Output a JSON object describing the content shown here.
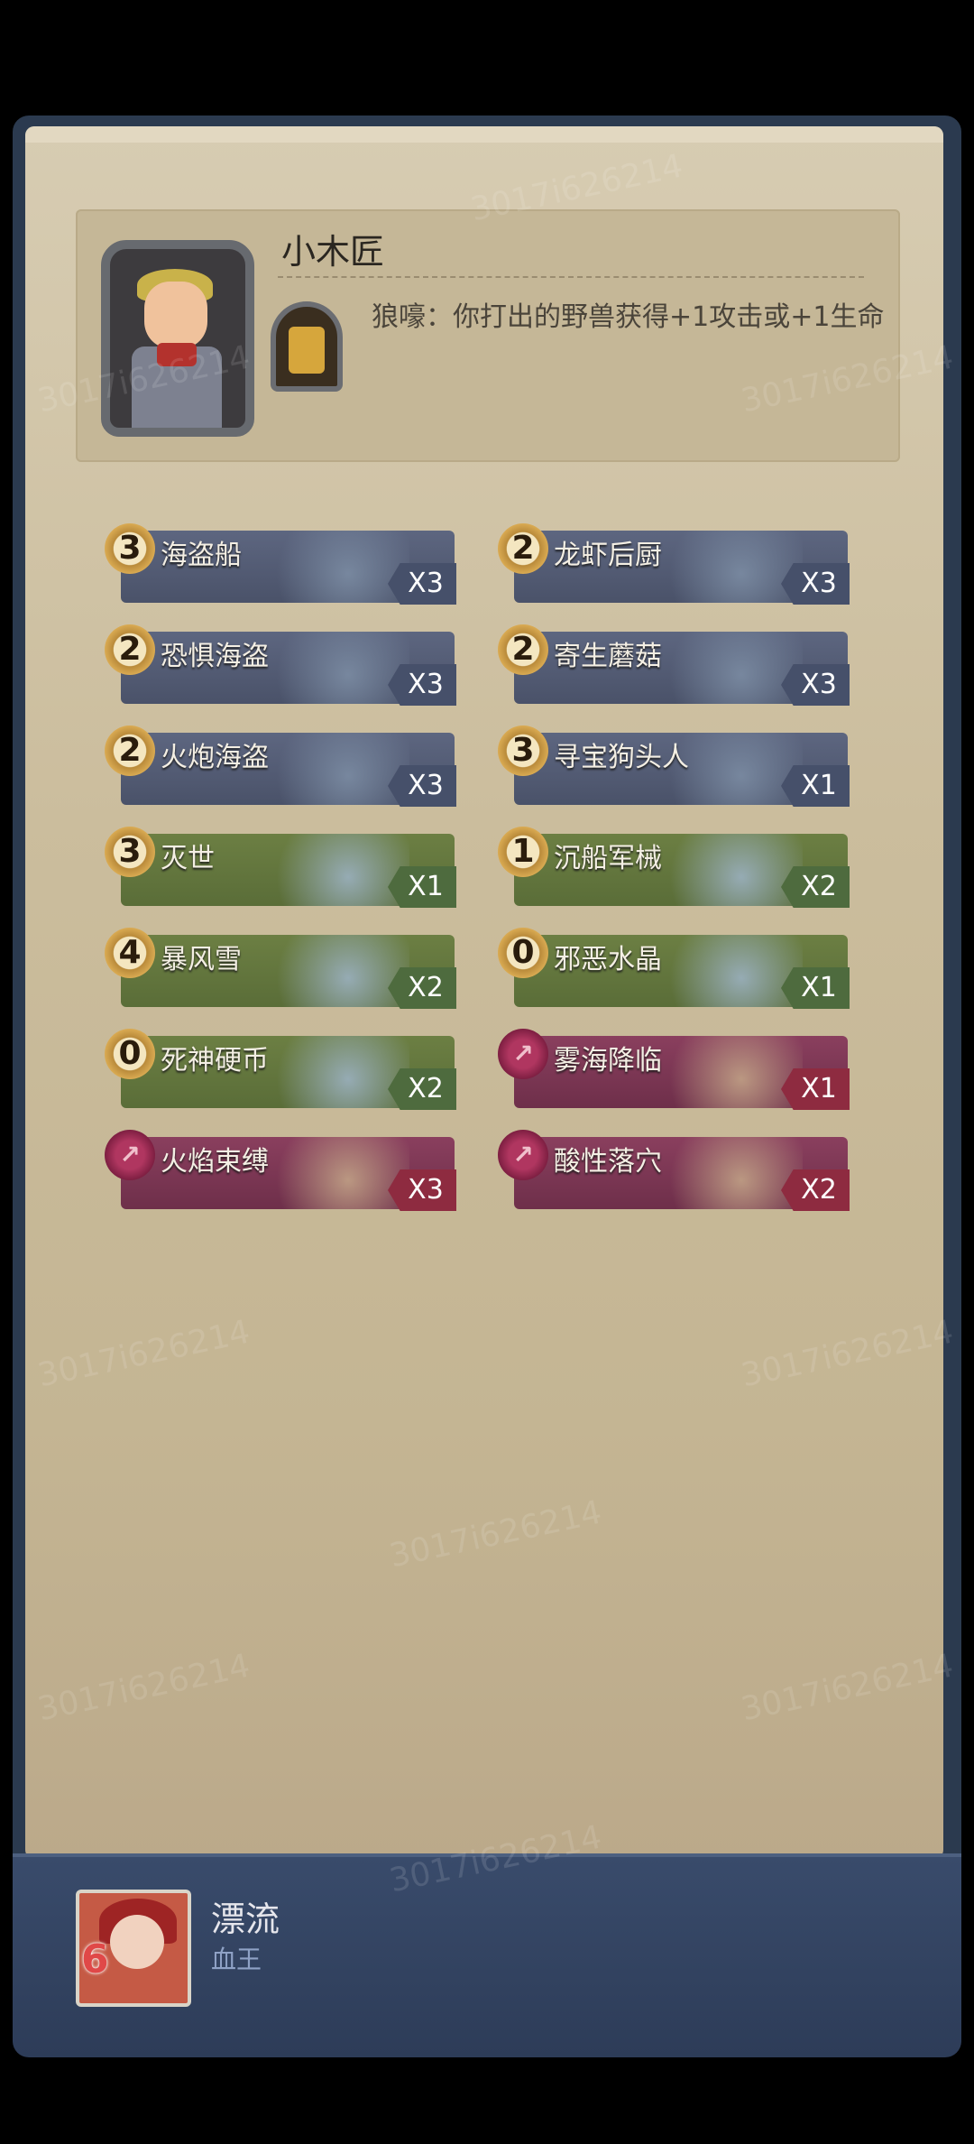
{
  "hero": {
    "name": "小木匠",
    "ability": "狼嚎：你打出的野兽获得+1攻击或+1生命"
  },
  "cards": [
    {
      "cost": "3",
      "name": "海盗船",
      "count": "X3",
      "kind": "minion"
    },
    {
      "cost": "2",
      "name": "龙虾后厨",
      "count": "X3",
      "kind": "minion"
    },
    {
      "cost": "2",
      "name": "恐惧海盗",
      "count": "X3",
      "kind": "minion"
    },
    {
      "cost": "2",
      "name": "寄生蘑菇",
      "count": "X3",
      "kind": "minion"
    },
    {
      "cost": "2",
      "name": "火炮海盗",
      "count": "X3",
      "kind": "minion"
    },
    {
      "cost": "3",
      "name": "寻宝狗头人",
      "count": "X1",
      "kind": "minion"
    },
    {
      "cost": "3",
      "name": "灭世",
      "count": "X1",
      "kind": "spell"
    },
    {
      "cost": "1",
      "name": "沉船军械",
      "count": "X2",
      "kind": "spell"
    },
    {
      "cost": "4",
      "name": "暴风雪",
      "count": "X2",
      "kind": "spell"
    },
    {
      "cost": "0",
      "name": "邪恶水晶",
      "count": "X1",
      "kind": "spell"
    },
    {
      "cost": "0",
      "name": "死神硬币",
      "count": "X2",
      "kind": "spell"
    },
    {
      "cost": "",
      "name": "雾海降临",
      "count": "X1",
      "kind": "quest"
    },
    {
      "cost": "",
      "name": "火焰束缚",
      "count": "X3",
      "kind": "quest"
    },
    {
      "cost": "",
      "name": "酸性落穴",
      "count": "X2",
      "kind": "quest"
    }
  ],
  "player": {
    "name": "漂流",
    "title": "血王",
    "rank": "6"
  },
  "watermark": "3017i626214"
}
